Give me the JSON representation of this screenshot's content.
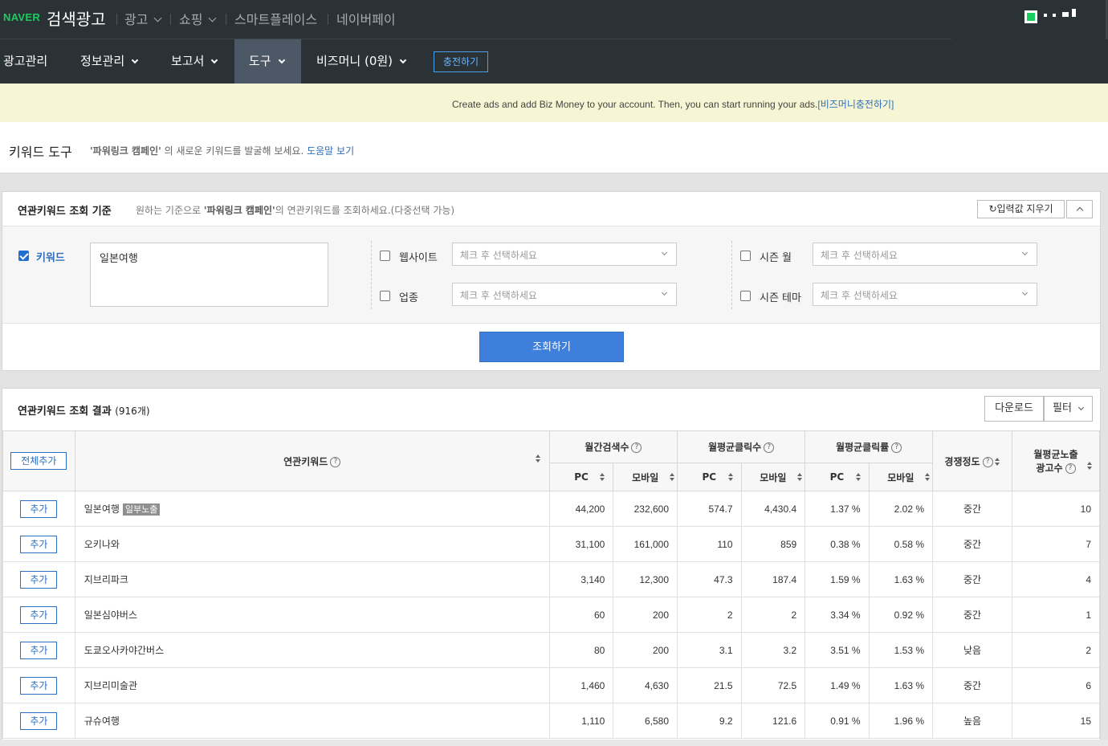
{
  "topbar": {
    "logo_naver": "NAVER",
    "logo_service": "검색광고",
    "links": [
      {
        "label": "광고",
        "dropdown": true
      },
      {
        "label": "쇼핑",
        "dropdown": true
      },
      {
        "label": "스마트플레이스",
        "dropdown": false
      },
      {
        "label": "네이버페이",
        "dropdown": false
      }
    ]
  },
  "navbar": {
    "items": [
      {
        "label": "광고관리",
        "dropdown": false
      },
      {
        "label": "정보관리",
        "dropdown": true
      },
      {
        "label": "보고서",
        "dropdown": true
      },
      {
        "label": "도구",
        "dropdown": true,
        "active": true
      },
      {
        "label": "비즈머니 (0원)",
        "dropdown": true
      }
    ],
    "charge_button": "충전하기"
  },
  "notice": {
    "message": "Create ads and add Biz Money to your account. Then, you can start running your ads.",
    "link": "[비즈머니충전하기]"
  },
  "page": {
    "title": "키워드 도구",
    "subtitle_campaign": "'파워링크 캠페인'",
    "subtitle_rest": " 의 새로운 키워드를 발굴해 보세요.",
    "help_link": "도움말 보기"
  },
  "query_panel": {
    "title": "연관키워드 조회 기준",
    "subtitle_prefix": "원하는 기준으로 ",
    "subtitle_campaign": "'파워링크 캠페인'",
    "subtitle_suffix": "의 연관키워드를 조회하세요.(다중선택 가능)",
    "reset_button": "입력값 지우기",
    "keyword_label": "키워드",
    "keyword_value": "일본여행",
    "website_label": "웹사이트",
    "industry_label": "업종",
    "season_month_label": "시즌 월",
    "season_theme_label": "시즌 테마",
    "select_placeholder": "체크 후 선택하세요",
    "search_button": "조회하기"
  },
  "results": {
    "title": "연관키워드 조회 결과",
    "count": "(916개)",
    "download_button": "다운로드",
    "filter_button": "필터",
    "add_all_button": "전체추가",
    "headers": {
      "keyword": "연관키워드",
      "monthly_search": "월간검색수",
      "monthly_clicks": "월평균클릭수",
      "monthly_ctr": "월평균클릭률",
      "competition": "경쟁정도",
      "ad_count_line1": "월평균노출",
      "ad_count_line2": "광고수",
      "pc": "PC",
      "mobile": "모바일"
    },
    "add_label": "추가",
    "rows": [
      {
        "keyword": "일본여행",
        "badge": "일부노출",
        "search_pc": "44,200",
        "search_mobile": "232,600",
        "clicks_pc": "574.7",
        "clicks_mobile": "4,430.4",
        "ctr_pc": "1.37 %",
        "ctr_mobile": "2.02 %",
        "competition": "중간",
        "ads": "10"
      },
      {
        "keyword": "오키나와",
        "badge": "",
        "search_pc": "31,100",
        "search_mobile": "161,000",
        "clicks_pc": "110",
        "clicks_mobile": "859",
        "ctr_pc": "0.38 %",
        "ctr_mobile": "0.58 %",
        "competition": "중간",
        "ads": "7"
      },
      {
        "keyword": "지브리파크",
        "badge": "",
        "search_pc": "3,140",
        "search_mobile": "12,300",
        "clicks_pc": "47.3",
        "clicks_mobile": "187.4",
        "ctr_pc": "1.59 %",
        "ctr_mobile": "1.63 %",
        "competition": "중간",
        "ads": "4"
      },
      {
        "keyword": "일본심야버스",
        "badge": "",
        "search_pc": "60",
        "search_mobile": "200",
        "clicks_pc": "2",
        "clicks_mobile": "2",
        "ctr_pc": "3.34 %",
        "ctr_mobile": "0.92 %",
        "competition": "중간",
        "ads": "1"
      },
      {
        "keyword": "도쿄오사카야간버스",
        "badge": "",
        "search_pc": "80",
        "search_mobile": "200",
        "clicks_pc": "3.1",
        "clicks_mobile": "3.2",
        "ctr_pc": "3.51 %",
        "ctr_mobile": "1.53 %",
        "competition": "낮음",
        "ads": "2"
      },
      {
        "keyword": "지브리미술관",
        "badge": "",
        "search_pc": "1,460",
        "search_mobile": "4,630",
        "clicks_pc": "21.5",
        "clicks_mobile": "72.5",
        "ctr_pc": "1.49 %",
        "ctr_mobile": "1.63 %",
        "competition": "중간",
        "ads": "6"
      },
      {
        "keyword": "규슈여행",
        "badge": "",
        "search_pc": "1,110",
        "search_mobile": "6,580",
        "clicks_pc": "9.2",
        "clicks_mobile": "121.6",
        "ctr_pc": "0.91 %",
        "ctr_mobile": "1.96 %",
        "competition": "높음",
        "ads": "15"
      }
    ]
  },
  "colors": {
    "topbar_bg": "#2b3236",
    "active_nav_bg": "#4d5866",
    "brand_green": "#19ce60",
    "link_blue": "#2e6fbd",
    "primary_button": "#3d7fdb",
    "notice_bg": "#f7f6d4"
  }
}
